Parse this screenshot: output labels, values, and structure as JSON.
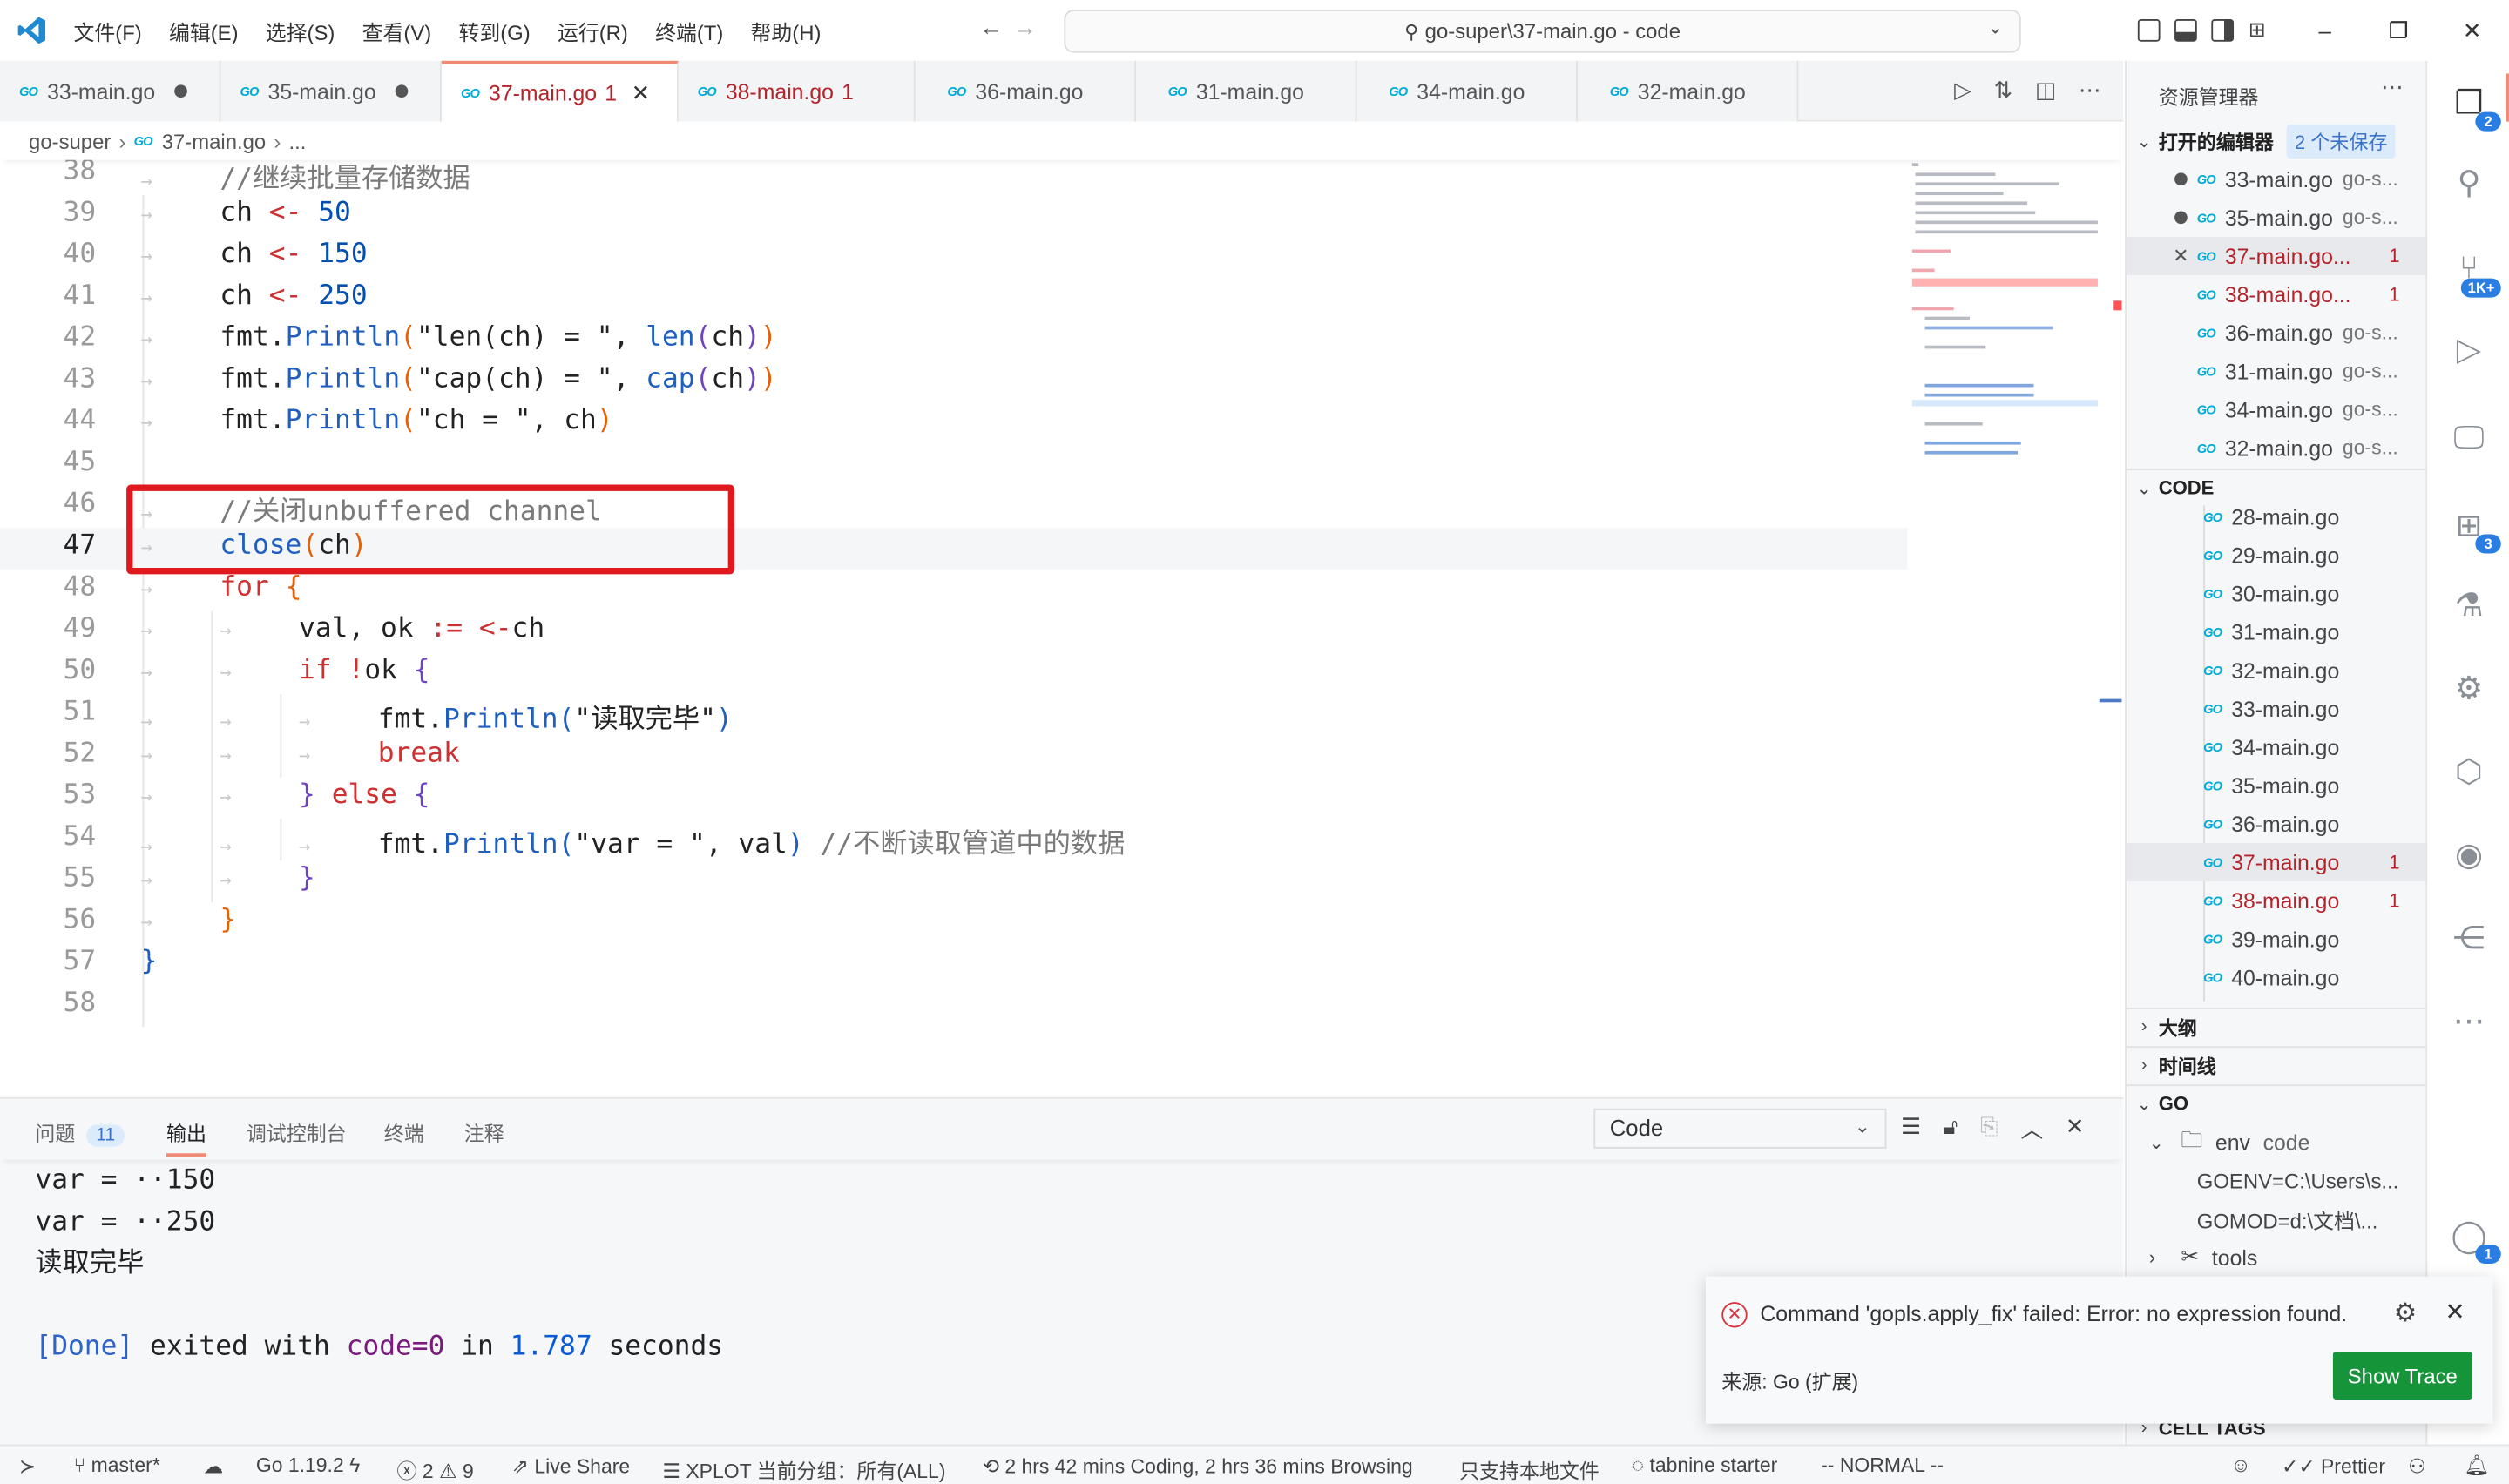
{
  "titlebar": {
    "menus": [
      "文件(F)",
      "编辑(E)",
      "选择(S)",
      "查看(V)",
      "转到(G)",
      "运行(R)",
      "终端(T)",
      "帮助(H)"
    ],
    "command_center": "go-super\\37-main.go - code",
    "window": {
      "minimize": "–",
      "restore": "❐",
      "close": "✕"
    }
  },
  "tabs": [
    {
      "label": "33-main.go",
      "state": "dirty"
    },
    {
      "label": "35-main.go",
      "state": "dirty"
    },
    {
      "label": "37-main.go",
      "badge": "1",
      "state": "active-error"
    },
    {
      "label": "38-main.go",
      "badge": "1",
      "state": "error"
    },
    {
      "label": "36-main.go"
    },
    {
      "label": "31-main.go"
    },
    {
      "label": "34-main.go"
    },
    {
      "label": "32-main.go"
    }
  ],
  "go_icon": "GO",
  "breadcrumb": {
    "folder": "go-super",
    "file": "37-main.go",
    "more": "..."
  },
  "editor": {
    "current_line": 47,
    "lines": [
      {
        "n": "38",
        "text": "//继续批量存储数据"
      },
      {
        "n": "39",
        "text": "ch <- 50"
      },
      {
        "n": "40",
        "text": "ch <- 150"
      },
      {
        "n": "41",
        "text": "ch <- 250"
      },
      {
        "n": "42",
        "text": "fmt.Println(\"len(ch) = \", len(ch))"
      },
      {
        "n": "43",
        "text": "fmt.Println(\"cap(ch) = \", cap(ch))"
      },
      {
        "n": "44",
        "text": "fmt.Println(\"ch = \", ch)"
      },
      {
        "n": "45",
        "text": ""
      },
      {
        "n": "46",
        "text": "//关闭unbuffered channel"
      },
      {
        "n": "47",
        "text": "close(ch)"
      },
      {
        "n": "48",
        "text": "for {"
      },
      {
        "n": "49",
        "text": "val, ok := <-ch"
      },
      {
        "n": "50",
        "text": "if !ok {"
      },
      {
        "n": "51",
        "text": "fmt.Println(\"读取完毕\")"
      },
      {
        "n": "52",
        "text": "break"
      },
      {
        "n": "53",
        "text": "} else {"
      },
      {
        "n": "54",
        "text": "fmt.Println(\"var = \", val) //不断读取管道中的数据"
      },
      {
        "n": "55",
        "text": "}"
      },
      {
        "n": "56",
        "text": "}"
      },
      {
        "n": "57",
        "text": "}"
      },
      {
        "n": "58",
        "text": ""
      }
    ],
    "tokens": {
      "comment_38": "//继续批量存储数据",
      "ch": "ch",
      "arrow": "<-",
      "v50": "50",
      "v150": "150",
      "v250": "250",
      "fmt": "fmt.",
      "println": "Println",
      "s_len": "\"len(ch) = \", ",
      "s_cap": "\"cap(ch) = \", ",
      "s_ch": "\"ch = \", ",
      "len": "len",
      "cap": "cap",
      "comment_46": "//关闭unbuffered channel",
      "close": "close",
      "for": "for",
      "val_ok": "val, ok ",
      "assign": ":=",
      "recv": "<-",
      "if": "if",
      "not": "!",
      "ok": "ok ",
      "s_done": "\"读取完毕\"",
      "break": "break",
      "else": "else",
      "s_var": "\"var = \", val",
      "comment_54": "//不断读取管道中的数据"
    }
  },
  "panel": {
    "tabs": [
      {
        "label": "问题",
        "badge": "11"
      },
      {
        "label": "输出",
        "active": true
      },
      {
        "label": "调试控制台"
      },
      {
        "label": "终端"
      },
      {
        "label": "注释"
      }
    ],
    "output_channel": "Code",
    "output_lines": [
      "var = ··150",
      "var = ··250",
      "读取完毕",
      ""
    ],
    "done": {
      "tag": "[Done]",
      "t1": " exited with ",
      "code": "code=0",
      "t2": " in ",
      "secs": "1.787",
      "t3": " seconds"
    }
  },
  "sidebar": {
    "title": "资源管理器",
    "open_editors": {
      "label": "打开的编辑器",
      "unsaved": "2 个未保存",
      "items": [
        {
          "name": "33-main.go",
          "desc": "go-s...",
          "lead": "dot"
        },
        {
          "name": "35-main.go",
          "desc": "go-s...",
          "lead": "dot"
        },
        {
          "name": "37-main.go...",
          "errors": "1",
          "lead": "close",
          "selected": true
        },
        {
          "name": "38-main.go...",
          "errors": "1"
        },
        {
          "name": "36-main.go",
          "desc": "go-s..."
        },
        {
          "name": "31-main.go",
          "desc": "go-s..."
        },
        {
          "name": "34-main.go",
          "desc": "go-s..."
        },
        {
          "name": "32-main.go",
          "desc": "go-s..."
        }
      ]
    },
    "code": {
      "label": "CODE",
      "files": [
        {
          "name": "28-main.go"
        },
        {
          "name": "29-main.go"
        },
        {
          "name": "30-main.go"
        },
        {
          "name": "31-main.go"
        },
        {
          "name": "32-main.go"
        },
        {
          "name": "33-main.go"
        },
        {
          "name": "34-main.go"
        },
        {
          "name": "35-main.go"
        },
        {
          "name": "36-main.go"
        },
        {
          "name": "37-main.go",
          "errors": "1",
          "selected": true
        },
        {
          "name": "38-main.go",
          "errors": "1"
        },
        {
          "name": "39-main.go"
        },
        {
          "name": "40-main.go"
        }
      ]
    },
    "outline": "大纲",
    "timeline": "时间线",
    "go": {
      "label": "GO",
      "env": "env",
      "env_desc": "code",
      "goenv": "GOENV=C:\\Users\\s...",
      "gomod": "GOMOD=d:\\文档\\...",
      "tools": "tools"
    },
    "cell_tags": "CELL TAGS"
  },
  "activitybar": {
    "explorer_badge": "2",
    "scm_badge": "1K+",
    "extensions_badge": "3",
    "account_badge": "1"
  },
  "notification": {
    "message": "Command 'gopls.apply_fix' failed: Error: no expression found.",
    "source": "来源: Go (扩展)",
    "button": "Show Trace"
  },
  "statusbar": {
    "branch": "master*",
    "go_version": "Go 1.19.2",
    "errors": "2",
    "warnings": "9",
    "live_share": "Live Share",
    "xplot": "XPLOT 当前分组：所有(ALL)",
    "wakatime": "2 hrs 42 mins Coding, 2 hrs 36 mins Browsing",
    "local_only": "只支持本地文件",
    "tabnine": "tabnine starter",
    "vim_mode": "-- NORMAL --",
    "prettier": "Prettier"
  }
}
